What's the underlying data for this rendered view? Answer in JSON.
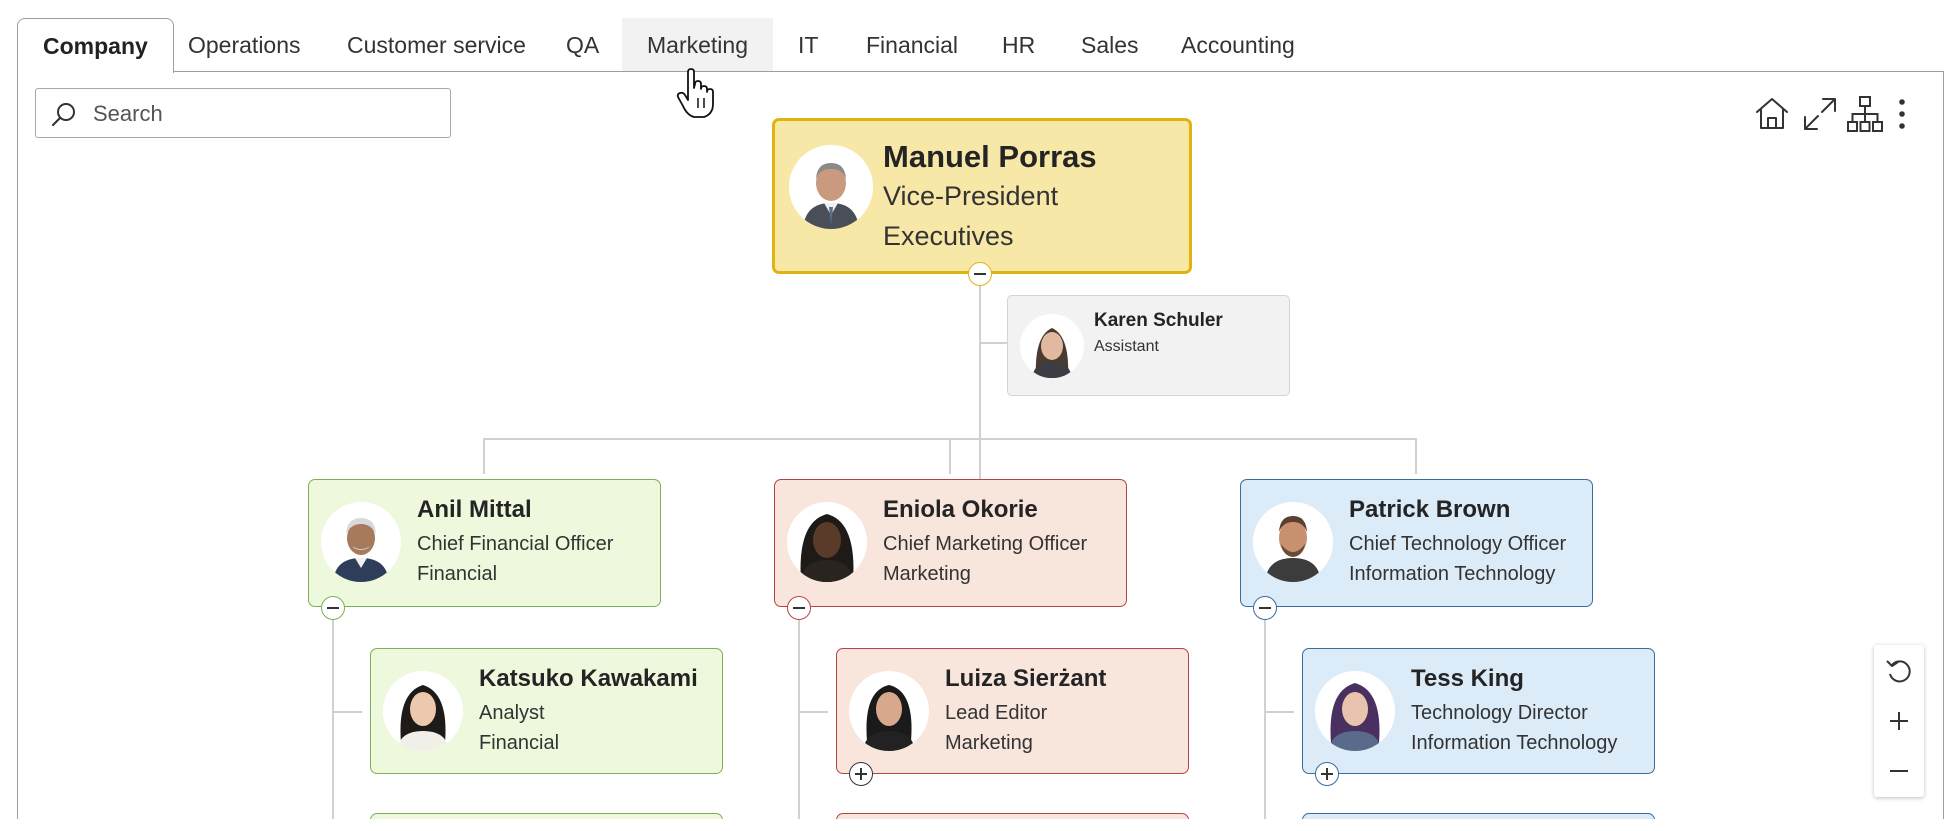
{
  "tabs": [
    {
      "label": "Company",
      "active": true
    },
    {
      "label": "Operations"
    },
    {
      "label": "Customer service"
    },
    {
      "label": "QA"
    },
    {
      "label": "Marketing",
      "hover": true
    },
    {
      "label": "IT"
    },
    {
      "label": "Financial"
    },
    {
      "label": "HR"
    },
    {
      "label": "Sales"
    },
    {
      "label": "Accounting"
    }
  ],
  "search": {
    "placeholder": "Search",
    "icon": "search-icon"
  },
  "toolbar": {
    "icons": [
      "home-icon",
      "expand-icon",
      "org-chart-icon",
      "more-vertical-icon"
    ]
  },
  "colors": {
    "root_bg": "#f8e8a8",
    "root_border": "#e0b40f",
    "financial_bg": "#eef8dc",
    "financial_border": "#7cb157",
    "marketing_bg": "#f8e5dc",
    "marketing_border": "#b54545",
    "it_bg": "#dcebf8",
    "it_border": "#3a6c9c",
    "assistant_bg": "#f2f2f2"
  },
  "org": {
    "root": {
      "name": "Manuel Porras",
      "title": "Vice-President",
      "dept": "Executives"
    },
    "assistant": {
      "name": "Karen Schuler",
      "title": "Assistant"
    },
    "executives": [
      {
        "name": "Anil Mittal",
        "title": "Chief Financial Officer",
        "dept": "Financial"
      },
      {
        "name": "Eniola Okorie",
        "title": "Chief Marketing Officer",
        "dept": "Marketing"
      },
      {
        "name": "Patrick Brown",
        "title": "Chief Technology Officer",
        "dept": "Information Technology"
      }
    ],
    "reports": [
      {
        "name": "Katsuko Kawakami",
        "title": "Analyst",
        "dept": "Financial"
      },
      {
        "name": "Luiza Sierżant",
        "title": "Lead Editor",
        "dept": "Marketing"
      },
      {
        "name": "Tess King",
        "title": "Technology Director",
        "dept": "Information Technology"
      }
    ]
  },
  "zoom_controls": [
    "reset-zoom-icon",
    "zoom-in-icon",
    "zoom-out-icon"
  ]
}
